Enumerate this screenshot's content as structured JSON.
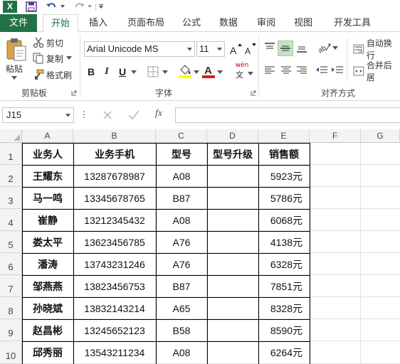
{
  "app": {
    "logo_letter": "X",
    "accent_color": "#217346"
  },
  "quick_access": {
    "icons": [
      "excel-logo-icon",
      "save-icon",
      "undo-icon",
      "redo-icon",
      "customize-icon"
    ]
  },
  "tabs": {
    "file": "文件",
    "home": "开始",
    "insert": "插入",
    "page_layout": "页面布局",
    "formulas": "公式",
    "data": "数据",
    "review": "审阅",
    "view": "视图",
    "developer": "开发工具"
  },
  "ribbon": {
    "clipboard": {
      "paste": "粘贴",
      "cut": "剪切",
      "copy": "复制",
      "format_painter": "格式刷",
      "group_label": "剪贴板"
    },
    "font": {
      "font_name": "Arial Unicode MS",
      "font_size": "11",
      "bold": "B",
      "italic": "I",
      "underline": "U",
      "phonetic": "wén",
      "group_label": "字体"
    },
    "alignment": {
      "wrap_text": "自动换行",
      "merge_center": "合并后居",
      "group_label": "对齐方式"
    }
  },
  "formula_bar": {
    "name_box": "J15",
    "fx": "fx",
    "formula": ""
  },
  "sheet": {
    "columns": [
      "A",
      "B",
      "C",
      "D",
      "E",
      "F",
      "G"
    ],
    "rows": [
      "1",
      "2",
      "3",
      "4",
      "5",
      "6",
      "7",
      "8",
      "9",
      "10"
    ],
    "headers": [
      "业务人",
      "业务手机",
      "型号",
      "型号升级",
      "销售额"
    ],
    "data": [
      {
        "name": "王耀东",
        "phone": "13287678987",
        "model": "A08",
        "upgrade": "",
        "sales": "5923元"
      },
      {
        "name": "马一鸣",
        "phone": "13345678765",
        "model": "B87",
        "upgrade": "",
        "sales": "5786元"
      },
      {
        "name": "崔静",
        "phone": "13212345432",
        "model": "A08",
        "upgrade": "",
        "sales": "6068元"
      },
      {
        "name": "娄太平",
        "phone": "13623456785",
        "model": "A76",
        "upgrade": "",
        "sales": "4138元"
      },
      {
        "name": "潘涛",
        "phone": "13743231246",
        "model": "A76",
        "upgrade": "",
        "sales": "6328元"
      },
      {
        "name": "邹燕燕",
        "phone": "13823456753",
        "model": "B87",
        "upgrade": "",
        "sales": "7851元"
      },
      {
        "name": "孙晓斌",
        "phone": "13832143214",
        "model": "A65",
        "upgrade": "",
        "sales": "8328元"
      },
      {
        "name": "赵昌彬",
        "phone": "13245652123",
        "model": "B58",
        "upgrade": "",
        "sales": "8590元"
      },
      {
        "name": "邱秀丽",
        "phone": "13543211234",
        "model": "A08",
        "upgrade": "",
        "sales": "6264元"
      }
    ]
  }
}
